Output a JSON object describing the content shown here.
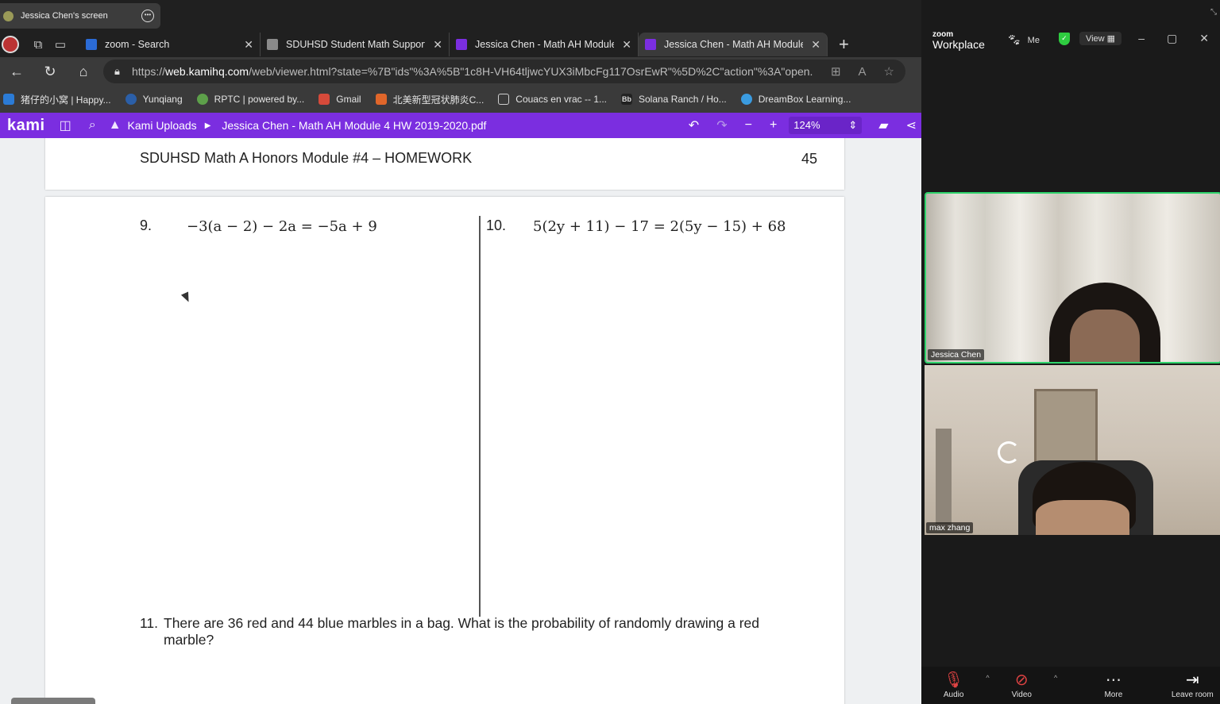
{
  "share_bar": {
    "label": "Jessica Chen's screen"
  },
  "tabs": [
    {
      "title": "zoom - Search",
      "fav_color": "#2b6bd6"
    },
    {
      "title": "SDUHSD Student Math Support",
      "fav_color": "#8a8a8a"
    },
    {
      "title": "Jessica Chen - Math AH Module",
      "fav_color": "#7b2ee0"
    },
    {
      "title": "Jessica Chen - Math AH Module",
      "fav_color": "#7b2ee0"
    }
  ],
  "address": {
    "scheme": "https://",
    "host": "web.kamihq.com",
    "path": "/web/viewer.html?state=%7B\"ids\"%3A%5B\"1c8H-VH64tljwcYUX3iMbcFg117OsrEwR\"%5D%2C\"action\"%3A\"open..."
  },
  "bookmarks": [
    {
      "label": "猪仔的小窝 | Happy...",
      "color": "#2b7bd6"
    },
    {
      "label": "Yunqiang",
      "color": "#2b5fa8"
    },
    {
      "label": "RPTC | powered by...",
      "color": "#5da04a"
    },
    {
      "label": "Gmail",
      "color": "#d64a3a"
    },
    {
      "label": "北美新型冠状肺炎C...",
      "color": "#e0662a"
    },
    {
      "label": "Couacs en vrac -- 1...",
      "color": "#cfcfcf"
    },
    {
      "label": "Solana Ranch / Ho...",
      "color": "#222222"
    },
    {
      "label": "DreamBox Learning...",
      "color": "#3a9be0"
    }
  ],
  "kami": {
    "logo": "kami",
    "breadcrumb": "Kami Uploads",
    "filename": "Jessica Chen - Math AH Module 4 HW 2019-2020.pdf",
    "zoom": "124%",
    "accent": "#7b2ee0"
  },
  "document": {
    "header_title": "SDUHSD Math A Honors Module #4 – HOMEWORK",
    "page_number": "45",
    "problems": [
      {
        "number": "9.",
        "equation": "−3(a − 2) − 2a = −5a + 9"
      },
      {
        "number": "10.",
        "equation": "5(2y + 11) − 17 = 2(5y − 15) + 68"
      }
    ],
    "q11": {
      "number": "11.",
      "text": "There are 36 red and 44 blue marbles in a bag.  What is the probability of randomly drawing a red marble?"
    }
  },
  "zoom": {
    "logo_small": "zoom",
    "logo_big": "Workplace",
    "me_label": "Me",
    "view_label": "View",
    "participants": [
      {
        "name": "Jessica Chen",
        "active_speaker": true
      },
      {
        "name": "max zhang",
        "active_speaker": false
      }
    ],
    "controls": [
      {
        "label": "Audio",
        "icon": "mic-muted-icon"
      },
      {
        "label": "Video",
        "icon": "video-off-icon"
      },
      {
        "label": "More",
        "icon": "more-icon"
      },
      {
        "label": "Leave room",
        "icon": "leave-room-icon"
      }
    ]
  }
}
